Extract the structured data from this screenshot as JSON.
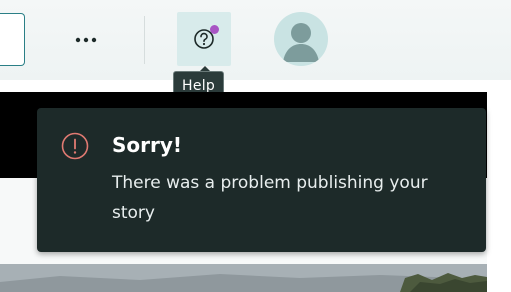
{
  "toolbar": {
    "more_icon": "more-horizontal-icon",
    "help_icon": "help-circle-icon",
    "avatar_icon": "user-avatar-icon"
  },
  "tooltip": {
    "label": "Help"
  },
  "toast": {
    "icon": "error-circle-icon",
    "title": "Sorry!",
    "message": "There was a problem publishing your story"
  },
  "colors": {
    "accent_teal": "#2a7f86",
    "notification_dot": "#a855c4",
    "toast_background": "#1d2a29",
    "error_icon": "#e07a72"
  }
}
